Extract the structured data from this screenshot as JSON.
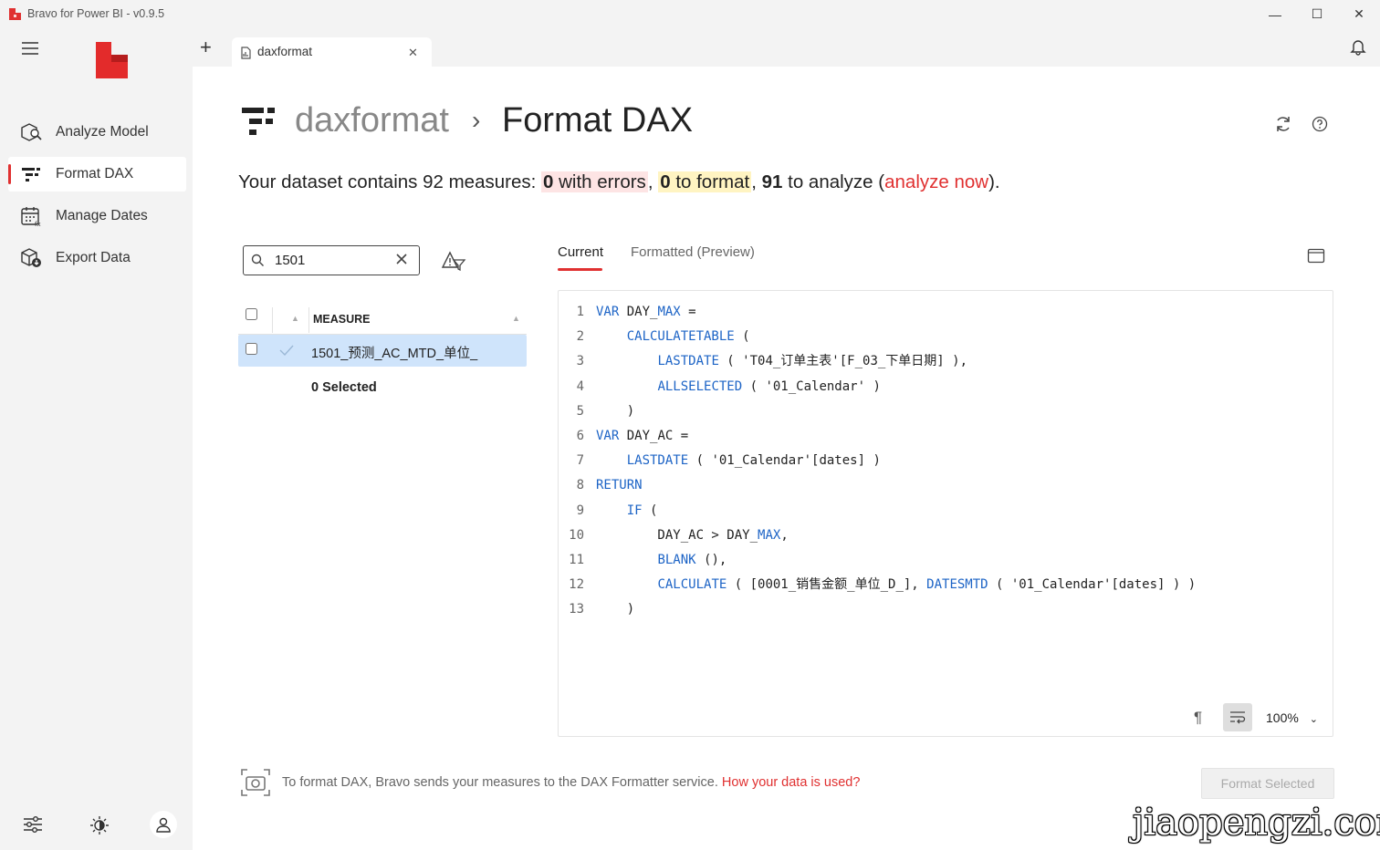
{
  "window": {
    "title": "Bravo for Power BI - v0.9.5",
    "minimize": "—",
    "maximize": "☐",
    "close": "✕"
  },
  "sidebar": {
    "items": [
      {
        "label": "Analyze Model",
        "icon": "analyze-model-icon"
      },
      {
        "label": "Format DAX",
        "icon": "format-dax-icon",
        "active": true
      },
      {
        "label": "Manage Dates",
        "icon": "manage-dates-icon"
      },
      {
        "label": "Export Data",
        "icon": "export-data-icon"
      }
    ]
  },
  "tabs": {
    "add": "+",
    "items": [
      {
        "label": "daxformat",
        "close": "✕"
      }
    ]
  },
  "header": {
    "dataset": "daxformat",
    "separator": "›",
    "page": "Format DAX"
  },
  "summary": {
    "prefix": "Your dataset contains 92 measures: ",
    "errors_count": "0",
    "errors_text": " with errors",
    "comma1": ", ",
    "format_count": "0",
    "format_text": " to format",
    "comma2": ", ",
    "analyze_count": "91",
    "analyze_text": " to analyze (",
    "analyze_link": "analyze now",
    "suffix": ")."
  },
  "search": {
    "value": "1501",
    "placeholder": ""
  },
  "list": {
    "column_header": "MEASURE",
    "rows": [
      {
        "name": "1501_预测_AC_MTD_单位_"
      }
    ],
    "selected_text": "0 Selected"
  },
  "preview_tabs": {
    "current": "Current",
    "formatted": "Formatted (Preview)"
  },
  "code": {
    "lines": [
      {
        "n": "1",
        "parts": [
          {
            "t": "VAR",
            "k": 1
          },
          {
            "t": " DAY_"
          },
          {
            "t": "MAX",
            "k": 1
          },
          {
            "t": " ="
          }
        ]
      },
      {
        "n": "2",
        "parts": [
          {
            "t": "    "
          },
          {
            "t": "CALCULATETABLE",
            "k": 1
          },
          {
            "t": " ("
          }
        ]
      },
      {
        "n": "3",
        "parts": [
          {
            "t": "        "
          },
          {
            "t": "LASTDATE",
            "k": 1
          },
          {
            "t": " ( 'T04_订单主表'[F_03_下单日期] ),"
          }
        ]
      },
      {
        "n": "4",
        "parts": [
          {
            "t": "        "
          },
          {
            "t": "ALLSELECTED",
            "k": 1
          },
          {
            "t": " ( '01_Calendar' )"
          }
        ]
      },
      {
        "n": "5",
        "parts": [
          {
            "t": "    )"
          }
        ]
      },
      {
        "n": "6",
        "parts": [
          {
            "t": "VAR",
            "k": 1
          },
          {
            "t": " DAY_AC ="
          }
        ]
      },
      {
        "n": "7",
        "parts": [
          {
            "t": "    "
          },
          {
            "t": "LASTDATE",
            "k": 1
          },
          {
            "t": " ( '01_Calendar'[dates] )"
          }
        ]
      },
      {
        "n": "8",
        "parts": [
          {
            "t": "RETURN",
            "k": 1
          }
        ]
      },
      {
        "n": "9",
        "parts": [
          {
            "t": "    "
          },
          {
            "t": "IF",
            "k": 1
          },
          {
            "t": " ("
          }
        ]
      },
      {
        "n": "10",
        "parts": [
          {
            "t": "        DAY_AC > DAY_"
          },
          {
            "t": "MAX",
            "k": 1
          },
          {
            "t": ","
          }
        ]
      },
      {
        "n": "11",
        "parts": [
          {
            "t": "        "
          },
          {
            "t": "BLANK",
            "k": 1
          },
          {
            "t": " (),"
          }
        ]
      },
      {
        "n": "12",
        "parts": [
          {
            "t": "        "
          },
          {
            "t": "CALCULATE",
            "k": 1
          },
          {
            "t": " ( [0001_销售金额_单位_D_], "
          },
          {
            "t": "DATESMTD",
            "k": 1
          },
          {
            "t": " ( '01_Calendar'[dates] ) )"
          }
        ]
      },
      {
        "n": "13",
        "parts": [
          {
            "t": "    )"
          }
        ]
      }
    ]
  },
  "editor_footer": {
    "pilcrow": "¶",
    "zoom": "100%"
  },
  "footer": {
    "notice": "To format DAX, Bravo sends your measures to the DAX Formatter service. ",
    "link": "How your data is used?",
    "button": "Format Selected"
  },
  "watermark": "jiaopengzi.com",
  "colors": {
    "accent": "#e03030",
    "keyword": "#1d64c6",
    "selected_row": "#cfe4fb"
  }
}
